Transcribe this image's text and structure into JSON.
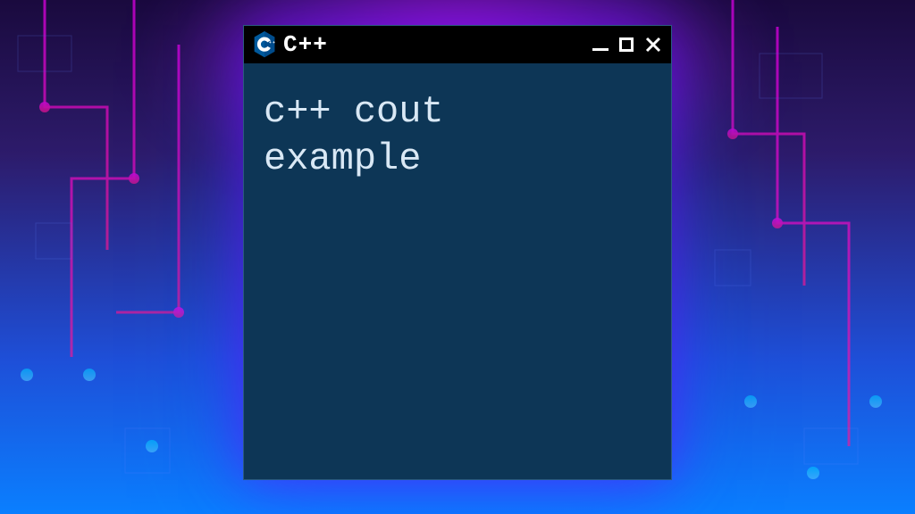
{
  "window": {
    "title": "C++",
    "content": "c++ cout\nexample",
    "icon_name": "cpp-logo-icon"
  },
  "controls": {
    "minimize": "minimize",
    "maximize": "maximize",
    "close": "close"
  },
  "colors": {
    "titlebar_bg": "#000000",
    "content_bg": "#0d3656",
    "text": "#d9e8f5",
    "icon_blue": "#00599C"
  }
}
